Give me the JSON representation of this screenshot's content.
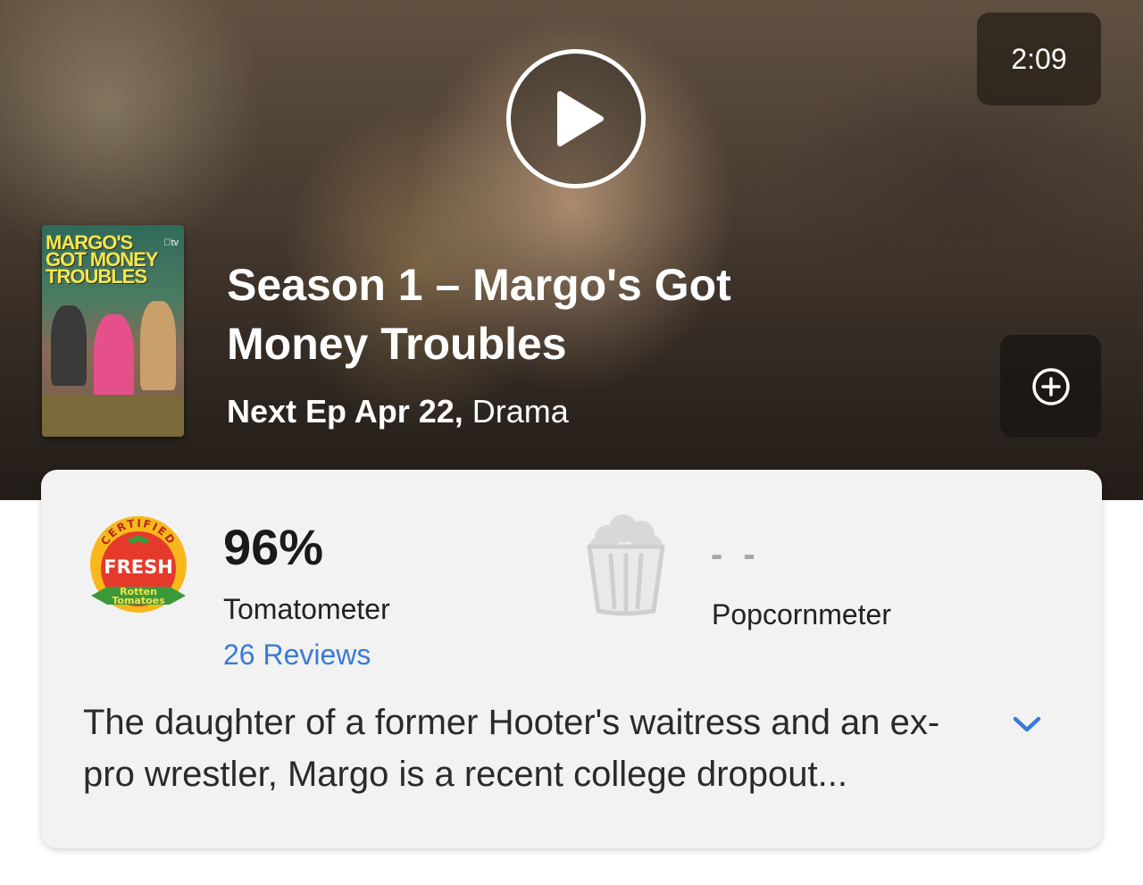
{
  "hero": {
    "duration": "2:09",
    "play_icon": "play-icon",
    "add_icon": "plus-circle-icon",
    "poster": {
      "title": "MARGO'S\nGOT MONEY\nTROUBLES",
      "brand": "tv"
    },
    "title": "Season 1 – Margo's Got Money Troubles",
    "next_ep": "Next Ep Apr 22,",
    "genre": "Drama"
  },
  "scores": {
    "badge": {
      "arc_text": "CERTIFIED",
      "fresh": "FRESH",
      "brand_line1": "Rotten",
      "brand_line2": "Tomatoes"
    },
    "tomatometer_value": "96%",
    "tomatometer_label": "Tomatometer",
    "reviews": "26 Reviews",
    "popcornmeter_value": "- -",
    "popcornmeter_label": "Popcornmeter"
  },
  "synopsis": "The daughter of a former Hooter's waitress and an ex-pro wrestler, Margo is a recent college dropout...",
  "colors": {
    "link": "#3a7bd5",
    "fresh_red": "#e53a2b",
    "fresh_yellow": "#f8b81c",
    "fresh_green": "#3a9a3a"
  }
}
